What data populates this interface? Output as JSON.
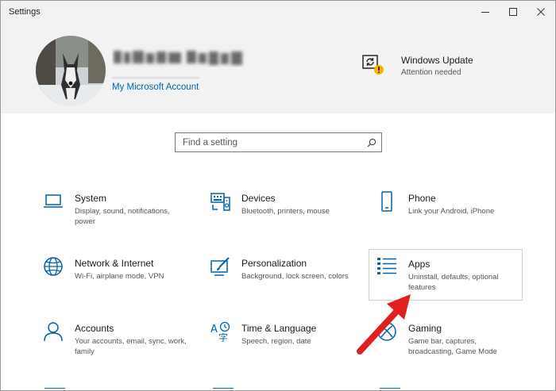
{
  "window": {
    "title": "Settings",
    "controls": [
      "minimize-icon",
      "maximize-icon",
      "close-icon"
    ]
  },
  "header": {
    "account_link": "My Microsoft Account",
    "update": {
      "title": "Windows Update",
      "status": "Attention needed",
      "icon": "sync-warning-icon"
    }
  },
  "search": {
    "placeholder": "Find a setting",
    "icon": "search-icon"
  },
  "tiles": [
    {
      "name": "System",
      "desc": "Display, sound, notifications, power",
      "icon": "laptop-icon"
    },
    {
      "name": "Devices",
      "desc": "Bluetooth, printers, mouse",
      "icon": "keyboard-speaker-icon"
    },
    {
      "name": "Phone",
      "desc": "Link your Android, iPhone",
      "icon": "phone-icon"
    },
    {
      "name": "Network & Internet",
      "desc": "Wi-Fi, airplane mode, VPN",
      "icon": "globe-icon"
    },
    {
      "name": "Personalization",
      "desc": "Background, lock screen, colors",
      "icon": "brush-screen-icon"
    },
    {
      "name": "Apps",
      "desc": "Uninstall, defaults, optional features",
      "icon": "apps-list-icon",
      "highlighted": true
    },
    {
      "name": "Accounts",
      "desc": "Your accounts, email, sync, work, family",
      "icon": "person-icon"
    },
    {
      "name": "Time & Language",
      "desc": "Speech, region, date",
      "icon": "time-language-icon"
    },
    {
      "name": "Gaming",
      "desc": "Game bar, captures, broadcasting, Game Mode",
      "icon": "xbox-icon"
    }
  ],
  "colors": {
    "accent": "#0063b1",
    "header_bg": "#f2f2f2",
    "warning": "#f7b500",
    "annotation_arrow": "#e02020"
  }
}
